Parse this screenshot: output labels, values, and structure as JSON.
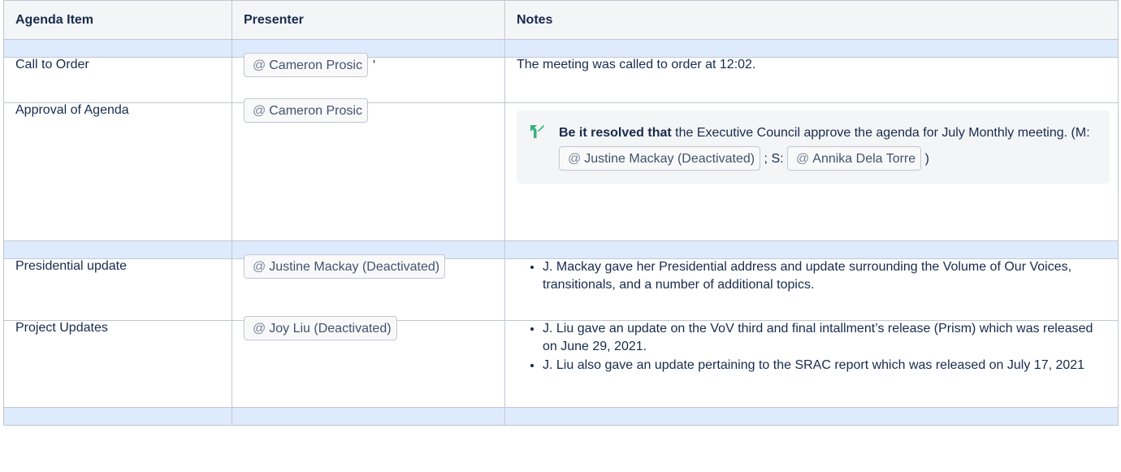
{
  "headers": {
    "agenda_item": "Agenda Item",
    "presenter": "Presenter",
    "notes": "Notes"
  },
  "rows": {
    "call_to_order": {
      "item": "Call to Order",
      "presenter": "Cameron Prosic",
      "trailing_mark": "'",
      "notes": "The meeting was called to order at 12:02."
    },
    "approval_of_agenda": {
      "item": "Approval of Agenda",
      "presenter": "Cameron Prosic",
      "decision": {
        "bold": "Be it resolved that",
        "text1": " the Executive Council approve the agenda for July Monthly meeting. (M: ",
        "mover": "Justine Mackay (Deactivated)",
        "text2": " ; S: ",
        "seconder": "Annika Dela Torre",
        "text3": " )"
      }
    },
    "presidential_update": {
      "item": "Presidential update",
      "presenter": "Justine Mackay (Deactivated)",
      "notes": [
        "J. Mackay gave her Presidential address and update surrounding the Volume of Our Voices, transitionals, and a number of additional topics."
      ]
    },
    "project_updates": {
      "item": "Project Updates",
      "presenter": "Joy Liu (Deactivated)",
      "notes": [
        "J. Liu gave an update on the VoV third and final intallment’s release (Prism) which was released on June 29, 2021.",
        "J. Liu also gave an update pertaining to the SRAC report which was released on July 17, 2021"
      ]
    }
  },
  "mention_symbol": "@",
  "colors": {
    "header_bg": "#f4f5f7",
    "spacer_bg": "#deebff",
    "decision_bg": "#f4f5f7",
    "decision_icon": "#36b37e",
    "mention_text": "#42526e"
  }
}
